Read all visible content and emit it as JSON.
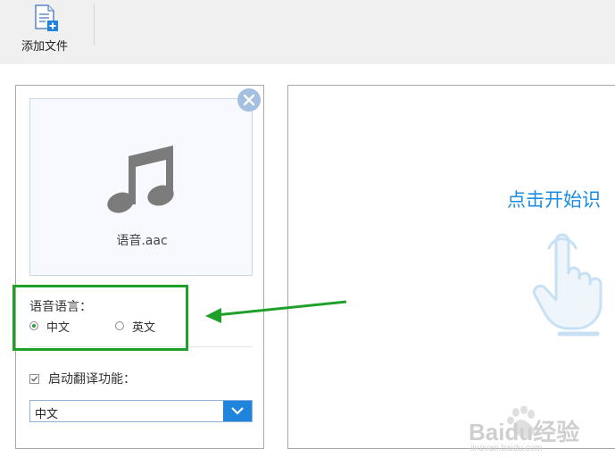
{
  "toolbar": {
    "add_file_label": "添加文件"
  },
  "file_card": {
    "file_name": "语音.aac"
  },
  "language": {
    "title": "语音语言：",
    "options": [
      {
        "label": "中文",
        "selected": true
      },
      {
        "label": "英文",
        "selected": false
      }
    ]
  },
  "translate": {
    "checkbox_label": "启动翻译功能：",
    "checked": true,
    "target_value": "中文"
  },
  "right_panel": {
    "start_text": "点击开始识"
  },
  "watermark": {
    "text": "Baidu经验",
    "sub": "jingyan.baidu.com"
  },
  "colors": {
    "accent_blue": "#1b8ce3",
    "annotation_green": "#1fa02b"
  }
}
